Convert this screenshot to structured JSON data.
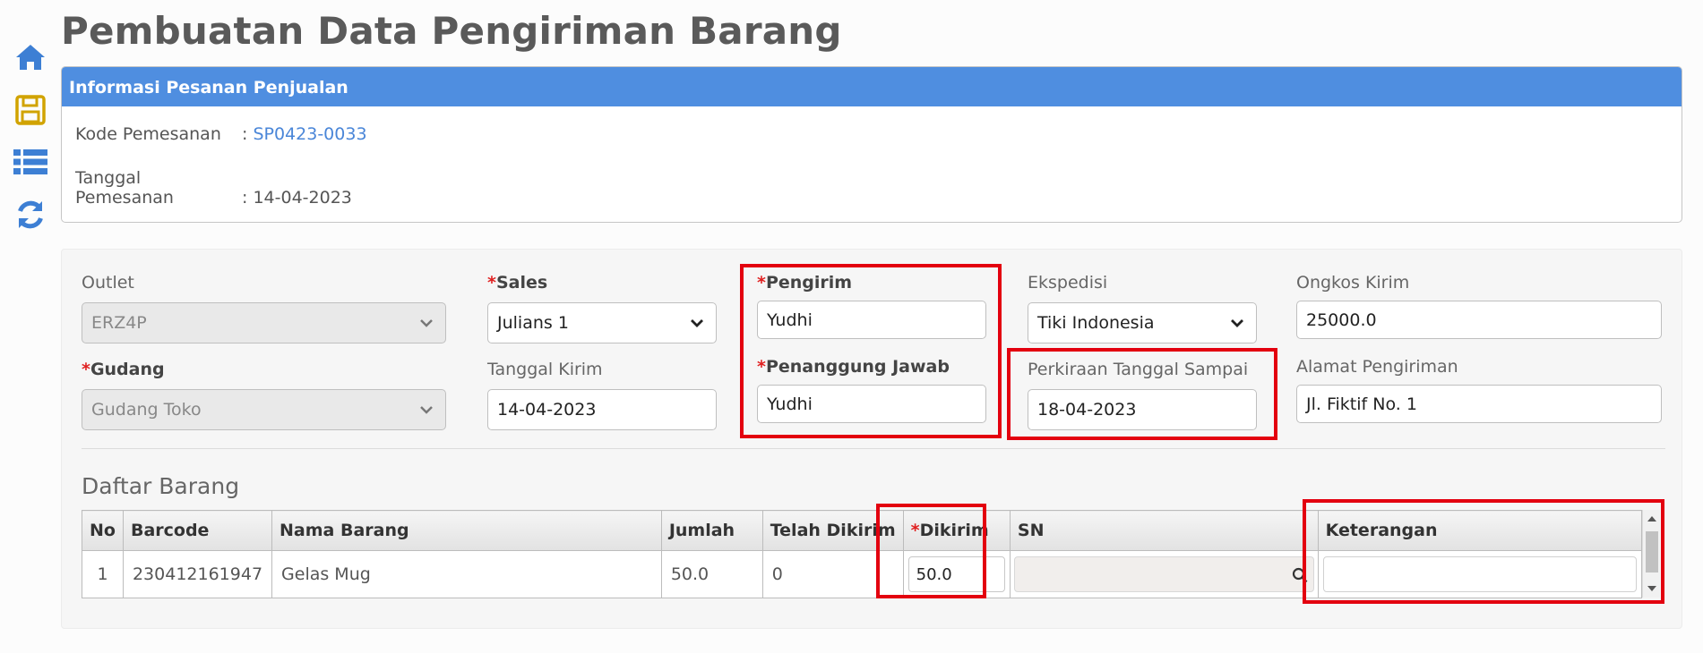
{
  "page": {
    "title": "Pembuatan Data Pengiriman Barang"
  },
  "sidebar": {
    "icons": [
      "home-icon",
      "save-icon",
      "list-icon",
      "refresh-icon"
    ]
  },
  "order_info": {
    "header": "Informasi Pesanan Penjualan",
    "kode_label": "Kode Pemesanan",
    "kode_value": "SP0423-0033",
    "tanggal_label": "Tanggal Pemesanan",
    "tanggal_value": "14-04-2023",
    "separator": ":"
  },
  "form": {
    "required_mark": "*",
    "outlet": {
      "label": "Outlet",
      "value": "ERZ4P"
    },
    "gudang": {
      "label": "Gudang",
      "value": "Gudang Toko"
    },
    "sales": {
      "label": "Sales",
      "value": "Julians 1"
    },
    "tanggal_kirim": {
      "label": "Tanggal Kirim",
      "value": "14-04-2023"
    },
    "pengirim": {
      "label": "Pengirim",
      "value": "Yudhi"
    },
    "penanggung_jawab": {
      "label": "Penanggung Jawab",
      "value": "Yudhi"
    },
    "ekspedisi": {
      "label": "Ekspedisi",
      "value": "Tiki Indonesia"
    },
    "perkiraan_tanggal_sampai": {
      "label": "Perkiraan Tanggal Sampai",
      "value": "18-04-2023"
    },
    "ongkos_kirim": {
      "label": "Ongkos Kirim",
      "value": "25000.0"
    },
    "alamat_pengiriman": {
      "label": "Alamat Pengiriman",
      "value": "Jl. Fiktif No. 1"
    }
  },
  "items": {
    "title": "Daftar Barang",
    "columns": [
      "No",
      "Barcode",
      "Nama Barang",
      "Jumlah",
      "Telah Dikirim",
      "Dikirim",
      "SN",
      "Keterangan"
    ],
    "rows": [
      {
        "no": "1",
        "barcode": "230412161947",
        "nama": "Gelas Mug",
        "jumlah": "50.0",
        "telah_dikirim": "0",
        "dikirim": "50.0",
        "sn": "",
        "keterangan": ""
      }
    ]
  },
  "colors": {
    "accent": "#4f8ee0",
    "highlight": "#e3000f",
    "required": "#e02020",
    "link": "#4a86d8"
  }
}
